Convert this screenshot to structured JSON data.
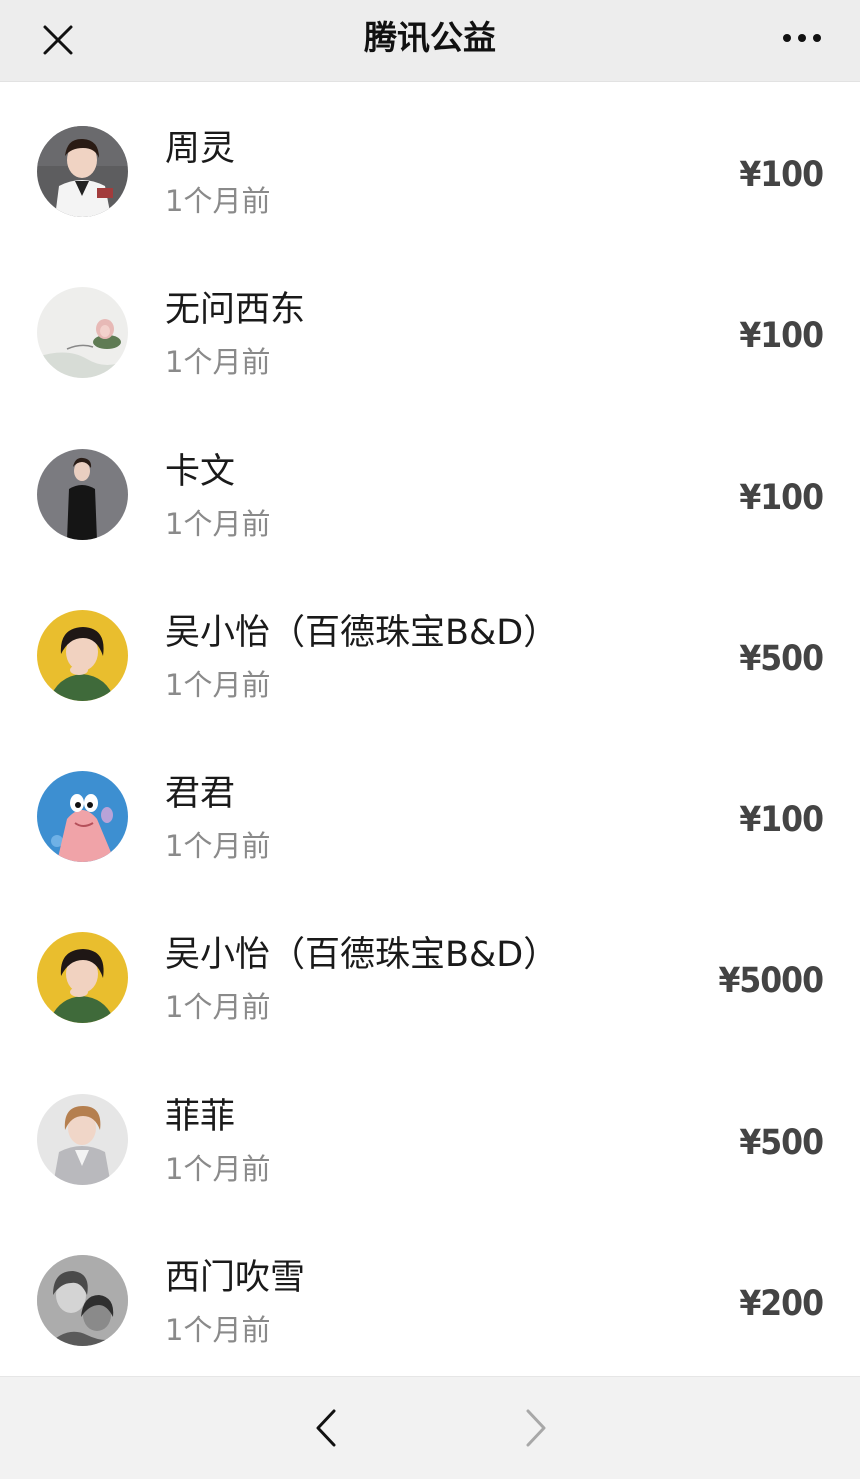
{
  "header": {
    "title": "腾讯公益",
    "close_icon": "close-icon",
    "more_icon": "more-dots-icon"
  },
  "donations": [
    {
      "name": "周灵",
      "time": "1个月前",
      "amount": "¥100",
      "avatar": "portrait-white-blazer"
    },
    {
      "name": "无问西东",
      "time": "1个月前",
      "amount": "¥100",
      "avatar": "lotus-ink-painting"
    },
    {
      "name": "卡文",
      "time": "1个月前",
      "amount": "¥100",
      "avatar": "portrait-black-dress"
    },
    {
      "name": "吴小怡（百德珠宝B&D）",
      "time": "1个月前",
      "amount": "¥500",
      "avatar": "portrait-yellow-background"
    },
    {
      "name": "君君",
      "time": "1个月前",
      "amount": "¥100",
      "avatar": "cartoon-starfish"
    },
    {
      "name": "吴小怡（百德珠宝B&D）",
      "time": "1个月前",
      "amount": "¥5000",
      "avatar": "portrait-yellow-background"
    },
    {
      "name": "菲菲",
      "time": "1个月前",
      "amount": "¥500",
      "avatar": "portrait-grey-suit"
    },
    {
      "name": "西门吹雪",
      "time": "1个月前",
      "amount": "¥200",
      "avatar": "bw-photo"
    }
  ],
  "footer": {
    "back_icon": "chevron-left-icon",
    "forward_icon": "chevron-right-icon"
  },
  "colors": {
    "header_bg": "#ededed",
    "footer_bg": "#f2f2f2",
    "amount": "#444444",
    "time": "#8a8a8a"
  }
}
